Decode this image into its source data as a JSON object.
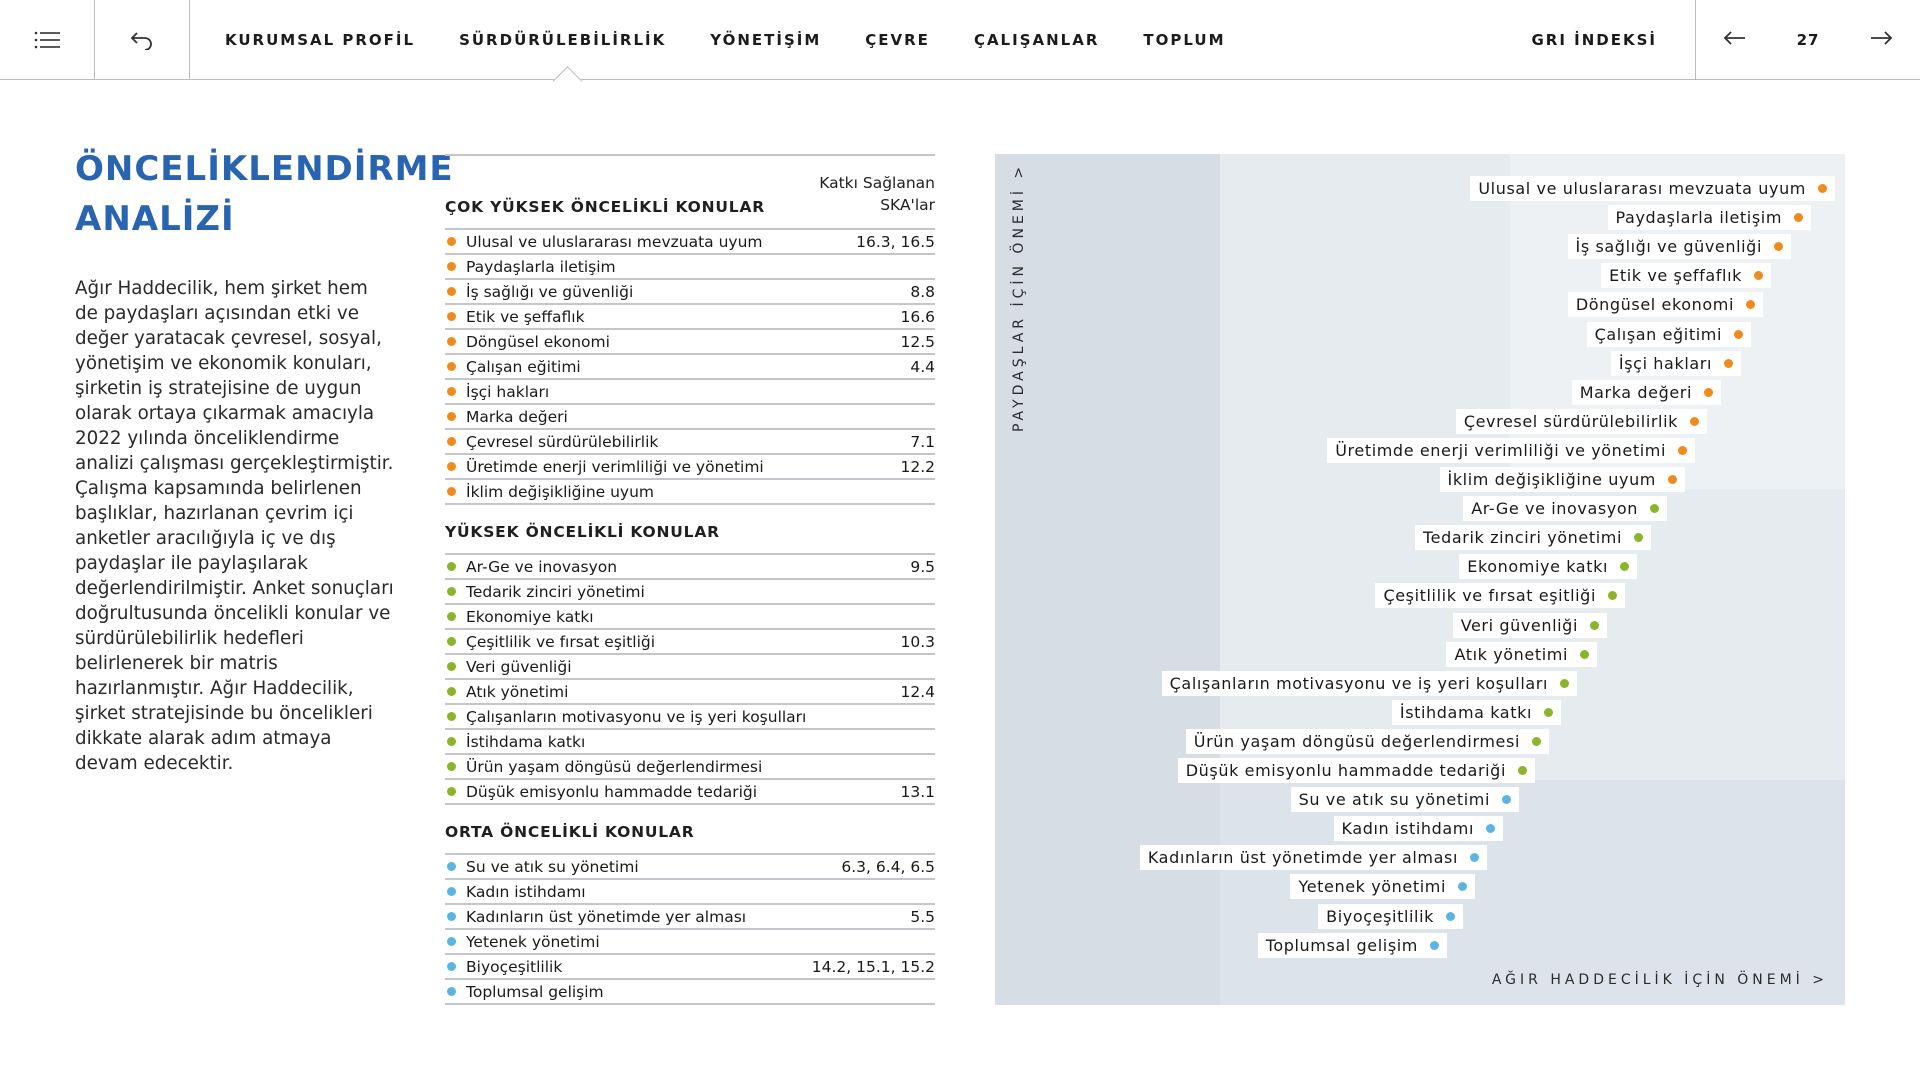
{
  "nav": {
    "items": [
      "KURUMSAL PROFİL",
      "SÜRDÜRÜLEBİLİRLİK",
      "YÖNETİŞİM",
      "ÇEVRE",
      "ÇALIŞANLAR",
      "TOPLUM"
    ],
    "active_index": 1,
    "gri": "GRI İNDEKSİ",
    "page": "27",
    "icons": {
      "menu": "menu-list-icon",
      "back": "return-arrow-icon",
      "prev": "arrow-left-icon",
      "next": "arrow-right-icon"
    }
  },
  "section": {
    "title_line1": "ÖNCELİKLENDİRME",
    "title_line2": "ANALİZİ",
    "intro": "Ağır Haddecilik, hem şirket hem de paydaşları açısından etki ve değer yaratacak çevresel, sosyal, yönetişim ve ekonomik konuları, şirketin iş stratejisine de uygun olarak ortaya çıkarmak amacıyla 2022 yılında önceliklendirme analizi çalışması gerçekleştirmiştir. Çalışma kapsamında belirlenen başlıklar, hazırlanan çevrim içi anketler aracılığıyla iç ve dış paydaşlar ile paylaşılarak değerlendirilmiştir. Anket sonuçları doğrultusunda öncelikli konular ve sürdürülebilirlik hedefleri belirlenerek bir matris hazırlanmıştır. Ağır Haddecilik, şirket stratejisinde bu öncelikleri dikkate alarak adım atmaya devam edecektir."
  },
  "colors": {
    "very_high": "#f08a1c",
    "high": "#8ab52a",
    "medium": "#5bb5e0",
    "title": "#2864b0"
  },
  "table": {
    "column_title": "Katkı Sağlanan SKA'lar",
    "groups": [
      {
        "title": "ÇOK YÜKSEK ÖNCELİKLİ KONULAR",
        "level": "very_high",
        "rows": [
          {
            "label": "Ulusal ve uluslararası mevzuata uyum",
            "value": "16.3, 16.5"
          },
          {
            "label": "Paydaşlarla iletişim",
            "value": ""
          },
          {
            "label": "İş sağlığı ve güvenliği",
            "value": "8.8"
          },
          {
            "label": "Etik ve şeffaflık",
            "value": "16.6"
          },
          {
            "label": "Döngüsel ekonomi",
            "value": "12.5"
          },
          {
            "label": "Çalışan eğitimi",
            "value": "4.4"
          },
          {
            "label": "İşçi hakları",
            "value": ""
          },
          {
            "label": "Marka değeri",
            "value": ""
          },
          {
            "label": "Çevresel sürdürülebilirlik",
            "value": "7.1"
          },
          {
            "label": "Üretimde enerji verimliliği ve yönetimi",
            "value": "12.2"
          },
          {
            "label": "İklim değişikliğine uyum",
            "value": ""
          }
        ]
      },
      {
        "title": "YÜKSEK ÖNCELİKLİ KONULAR",
        "level": "high",
        "rows": [
          {
            "label": "Ar-Ge ve inovasyon",
            "value": "9.5"
          },
          {
            "label": "Tedarik zinciri yönetimi",
            "value": ""
          },
          {
            "label": "Ekonomiye katkı",
            "value": ""
          },
          {
            "label": "Çeşitlilik ve fırsat eşitliği",
            "value": "10.3"
          },
          {
            "label": "Veri güvenliği",
            "value": ""
          },
          {
            "label": "Atık yönetimi",
            "value": "12.4"
          },
          {
            "label": "Çalışanların motivasyonu ve iş yeri koşulları",
            "value": ""
          },
          {
            "label": "İstihdama katkı",
            "value": ""
          },
          {
            "label": "Ürün yaşam döngüsü değerlendirmesi",
            "value": ""
          },
          {
            "label": "Düşük emisyonlu hammadde tedariği",
            "value": "13.1"
          }
        ]
      },
      {
        "title": "ORTA ÖNCELİKLİ KONULAR",
        "level": "medium",
        "rows": [
          {
            "label": "Su ve atık su yönetimi",
            "value": "6.3, 6.4, 6.5"
          },
          {
            "label": "Kadın istihdamı",
            "value": ""
          },
          {
            "label": "Kadınların üst yönetimde yer alması",
            "value": "5.5"
          },
          {
            "label": "Yetenek yönetimi",
            "value": ""
          },
          {
            "label": "Biyoçeşitlilik",
            "value": "14.2, 15.1, 15.2"
          },
          {
            "label": "Toplumsal gelişim",
            "value": ""
          }
        ]
      }
    ]
  },
  "matrix": {
    "y_label": "PAYDAŞLAR İÇİN ÖNEMİ >",
    "x_label": "AĞIR HADDECİLİK İÇİN ÖNEMİ >",
    "items": [
      {
        "label": "Ulusal ve uluslararası mevzuata uyum",
        "level": "very_high"
      },
      {
        "label": "Paydaşlarla iletişim",
        "level": "very_high"
      },
      {
        "label": "İş sağlığı ve güvenliği",
        "level": "very_high"
      },
      {
        "label": "Etik ve şeffaflık",
        "level": "very_high"
      },
      {
        "label": "Döngüsel ekonomi",
        "level": "very_high"
      },
      {
        "label": "Çalışan eğitimi",
        "level": "very_high"
      },
      {
        "label": "İşçi hakları",
        "level": "very_high"
      },
      {
        "label": "Marka değeri",
        "level": "very_high"
      },
      {
        "label": "Çevresel sürdürülebilirlik",
        "level": "very_high"
      },
      {
        "label": "Üretimde enerji verimliliği ve yönetimi",
        "level": "very_high"
      },
      {
        "label": "İklim değişikliğine uyum",
        "level": "very_high"
      },
      {
        "label": "Ar-Ge ve inovasyon",
        "level": "high"
      },
      {
        "label": "Tedarik zinciri yönetimi",
        "level": "high"
      },
      {
        "label": "Ekonomiye katkı",
        "level": "high"
      },
      {
        "label": "Çeşitlilik ve fırsat eşitliği",
        "level": "high"
      },
      {
        "label": "Veri güvenliği",
        "level": "high"
      },
      {
        "label": "Atık yönetimi",
        "level": "high"
      },
      {
        "label": "Çalışanların motivasyonu ve iş yeri koşulları",
        "level": "high"
      },
      {
        "label": "İstihdama katkı",
        "level": "high"
      },
      {
        "label": "Ürün yaşam döngüsü değerlendirmesi",
        "level": "high"
      },
      {
        "label": "Düşük emisyonlu hammadde tedariği",
        "level": "high"
      },
      {
        "label": "Su ve atık su yönetimi",
        "level": "medium"
      },
      {
        "label": "Kadın istihdamı",
        "level": "medium"
      },
      {
        "label": "Kadınların üst yönetimde yer alması",
        "level": "medium"
      },
      {
        "label": "Yetenek yönetimi",
        "level": "medium"
      },
      {
        "label": "Biyoçeşitlilik",
        "level": "medium"
      },
      {
        "label": "Toplumsal gelişim",
        "level": "medium"
      }
    ]
  }
}
